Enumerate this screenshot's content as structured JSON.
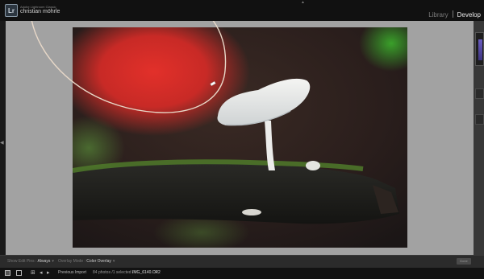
{
  "app": {
    "logo": "Lr",
    "app_name": "Adobe Lightroom Classic",
    "user_name": "christian möhrle"
  },
  "modules": {
    "library": "Library",
    "develop": "Develop",
    "active": "Develop"
  },
  "toolbar": {
    "show_edit_pins_label": "Show Edit Pins :",
    "show_edit_pins_value": "Always",
    "overlay_mode_label": "Overlay Mode :",
    "overlay_mode_value": "Color Overlay",
    "done_label": "Done"
  },
  "filmstrip": {
    "source": "Previous Import",
    "count_text": "84 photos /1 selected /",
    "filename": "IMG_6140.CR2"
  },
  "icons": {
    "prev": "arrow-left-icon",
    "next": "arrow-right-icon",
    "grid": "grid-icon",
    "single": "single-view-icon",
    "caret": "caret-down-icon"
  },
  "colors": {
    "canvas_bg": "#a2a2a2",
    "mask_curve": "#e8d8c8",
    "active_module": "#e8e8e8"
  }
}
